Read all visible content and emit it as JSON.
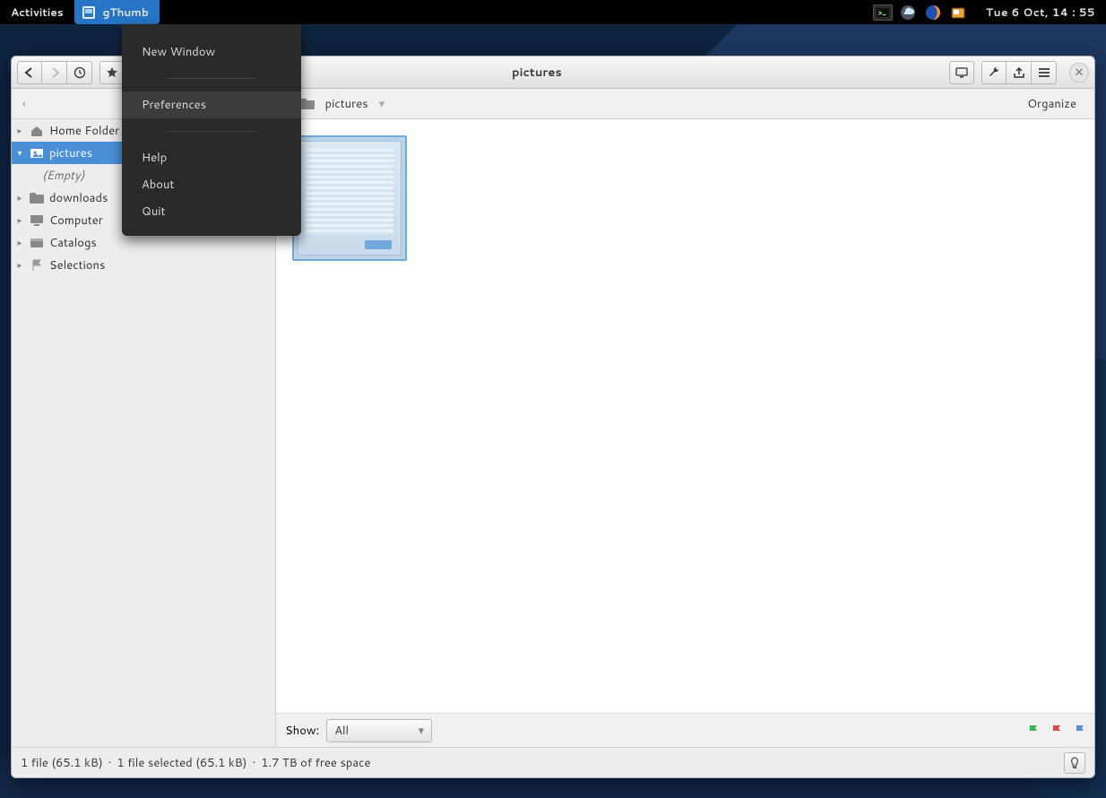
{
  "topbar": {
    "activities": "Activities",
    "app_name": "gThumb",
    "clock": "Tue  6 Oct, 14 : 55"
  },
  "appmenu": {
    "new_window": "New Window",
    "preferences": "Preferences",
    "help": "Help",
    "about": "About",
    "quit": "Quit"
  },
  "header": {
    "title": "pictures"
  },
  "pathbar": {
    "location": "pictures",
    "organize": "Organize"
  },
  "sidebar": {
    "items": [
      {
        "label": "Home Folder"
      },
      {
        "label": "pictures"
      },
      {
        "label": "(Empty)"
      },
      {
        "label": "downloads"
      },
      {
        "label": "Computer"
      },
      {
        "label": "Catalogs"
      },
      {
        "label": "Selections"
      }
    ]
  },
  "showbar": {
    "label": "Show:",
    "value": "All"
  },
  "status": {
    "files": "1 file (65.1 kB)",
    "selected": "1 file selected (65.1 kB)",
    "free": "1.7 TB of free space",
    "sep": "·"
  }
}
